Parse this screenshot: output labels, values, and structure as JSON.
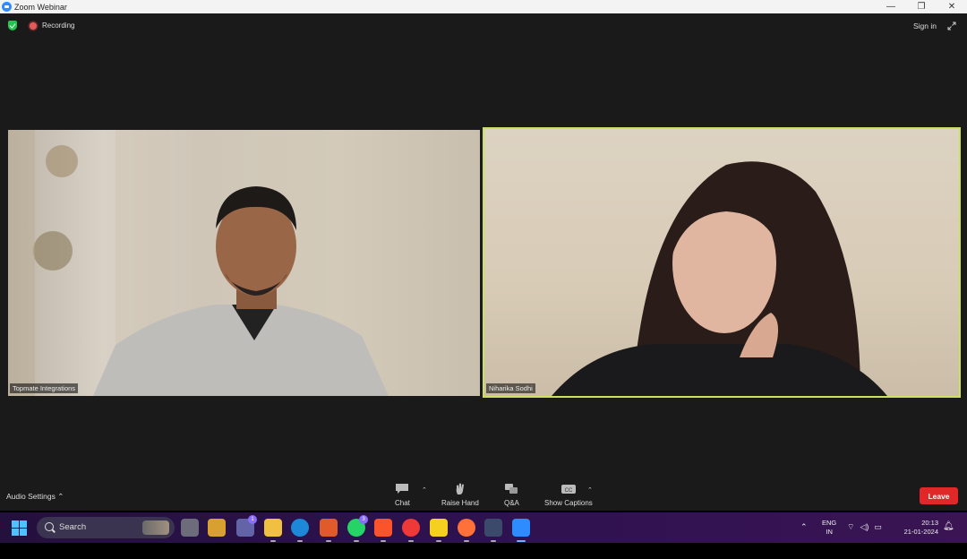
{
  "window": {
    "title": "Zoom Webinar",
    "controls": [
      "—",
      "❐",
      "✕"
    ]
  },
  "meeting": {
    "recording_label": "Recording",
    "sign_in": "Sign in"
  },
  "participants": [
    {
      "name": "Topmate Integrations"
    },
    {
      "name": "Niharika Sodhi"
    }
  ],
  "controls": {
    "audio_settings": "Audio Settings",
    "chat": "Chat",
    "raise_hand": "Raise Hand",
    "qa": "Q&A",
    "show_captions": "Show Captions",
    "leave": "Leave"
  },
  "taskbar": {
    "search_placeholder": "Search",
    "apps": [
      "task-view",
      "file-explorer",
      "teams",
      "folder",
      "edge",
      "mail",
      "whatsapp",
      "brave",
      "vivaldi",
      "sticky-notes",
      "firefox",
      "snipping-tool",
      "zoom"
    ],
    "whatsapp_badge": "3",
    "teams_badge": "1",
    "lang_line1": "ENG",
    "lang_line2": "IN",
    "time": "20:13",
    "date": "21-01-2024"
  },
  "colors": {
    "accent_active_speaker": "#cbe05d",
    "leave_button": "#e02828",
    "zoom_blue": "#2d8cff"
  }
}
